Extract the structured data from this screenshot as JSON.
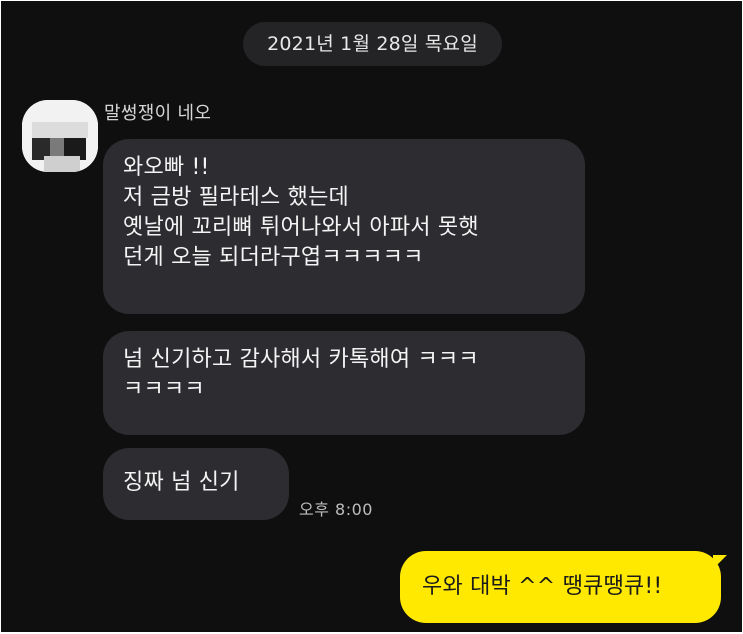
{
  "date_divider": "2021년 1월 28일 목요일",
  "sender": {
    "name": "말썽쟁이 네오"
  },
  "incoming_messages": [
    {
      "lines": [
        "와오빠 !!",
        "저 금방 필라테스 했는데",
        "옛날에 꼬리뼈 튀어나와서 아파서 못햇",
        "던게 오늘 되더라구엽ㅋㅋㅋㅋㅋ"
      ]
    },
    {
      "lines": [
        "넘 신기하고 감사해서 카톡해여 ㅋㅋㅋ",
        "ㅋㅋㅋㅋ"
      ]
    },
    {
      "lines": [
        "징짜 넘 신기"
      ]
    }
  ],
  "incoming_time": "오후 8:00",
  "outgoing_message": "우와 대박 ^^ 땡큐땡큐!!",
  "colors": {
    "background": "#0f0f10",
    "incoming_bubble": "#2d2c30",
    "outgoing_bubble": "#ffe900",
    "date_pill": "#242426"
  }
}
